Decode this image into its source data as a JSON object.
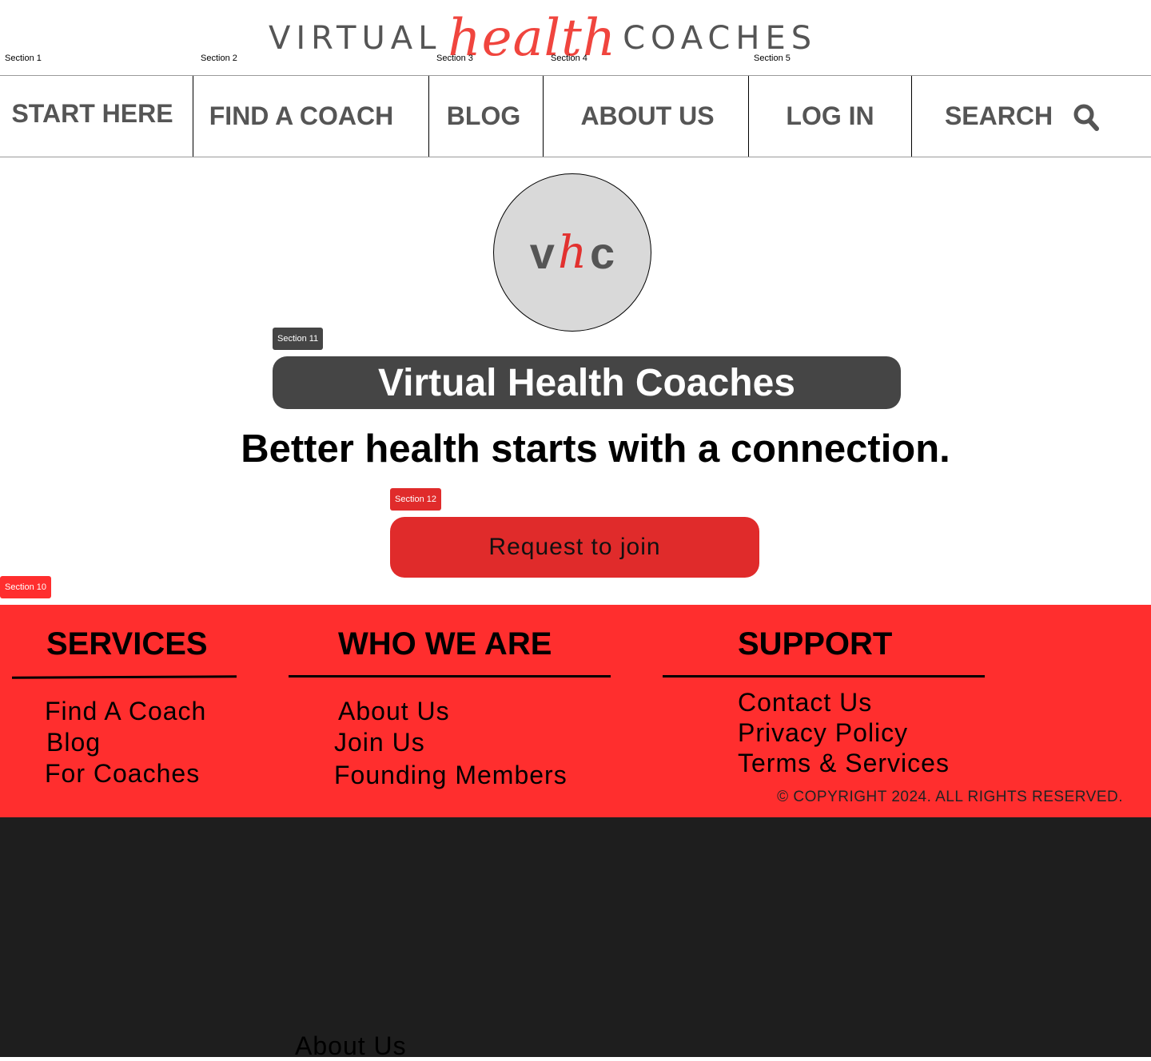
{
  "sections": {
    "s1": "Section 1",
    "s2": "Section 2",
    "s3": "Section 3",
    "s4": "Section 4",
    "s5": "Section 5",
    "s10": "Section 10",
    "s11": "Section 11",
    "s12": "Section 12"
  },
  "logo": {
    "left": "VIRTUAL",
    "script": "health",
    "right": "COACHES"
  },
  "nav": {
    "start": "START HERE",
    "find": "FIND  A COACH",
    "blog": "BLOG",
    "about": "ABOUT US",
    "login": "LOG IN",
    "search": "SEARCH",
    "search_icon": "search-icon"
  },
  "hero": {
    "avatar": {
      "v": "v",
      "h": "h",
      "c": "c"
    },
    "title": "Virtual Health Coaches",
    "headline": "Better health starts with a connection.",
    "cta": "Request to join"
  },
  "footer": {
    "services": {
      "heading": "SERVICES",
      "links": [
        "Find A Coach",
        "Blog",
        "For Coaches"
      ]
    },
    "who": {
      "heading": "WHO WE ARE",
      "links": [
        "About Us",
        "Join Us",
        "Founding Members"
      ]
    },
    "support": {
      "heading": "SUPPORT",
      "links": [
        "Contact Us",
        "Privacy Policy",
        "Terms & Services"
      ]
    },
    "copyright": "© COPYRIGHT 2024. ALL RIGHTS RESERVED."
  },
  "dark": {
    "link": "About Us"
  },
  "colors": {
    "accent": "#ff2e2e",
    "cta": "#e02b2b",
    "title_bg": "#454545",
    "dark": "#1e1e1e"
  }
}
